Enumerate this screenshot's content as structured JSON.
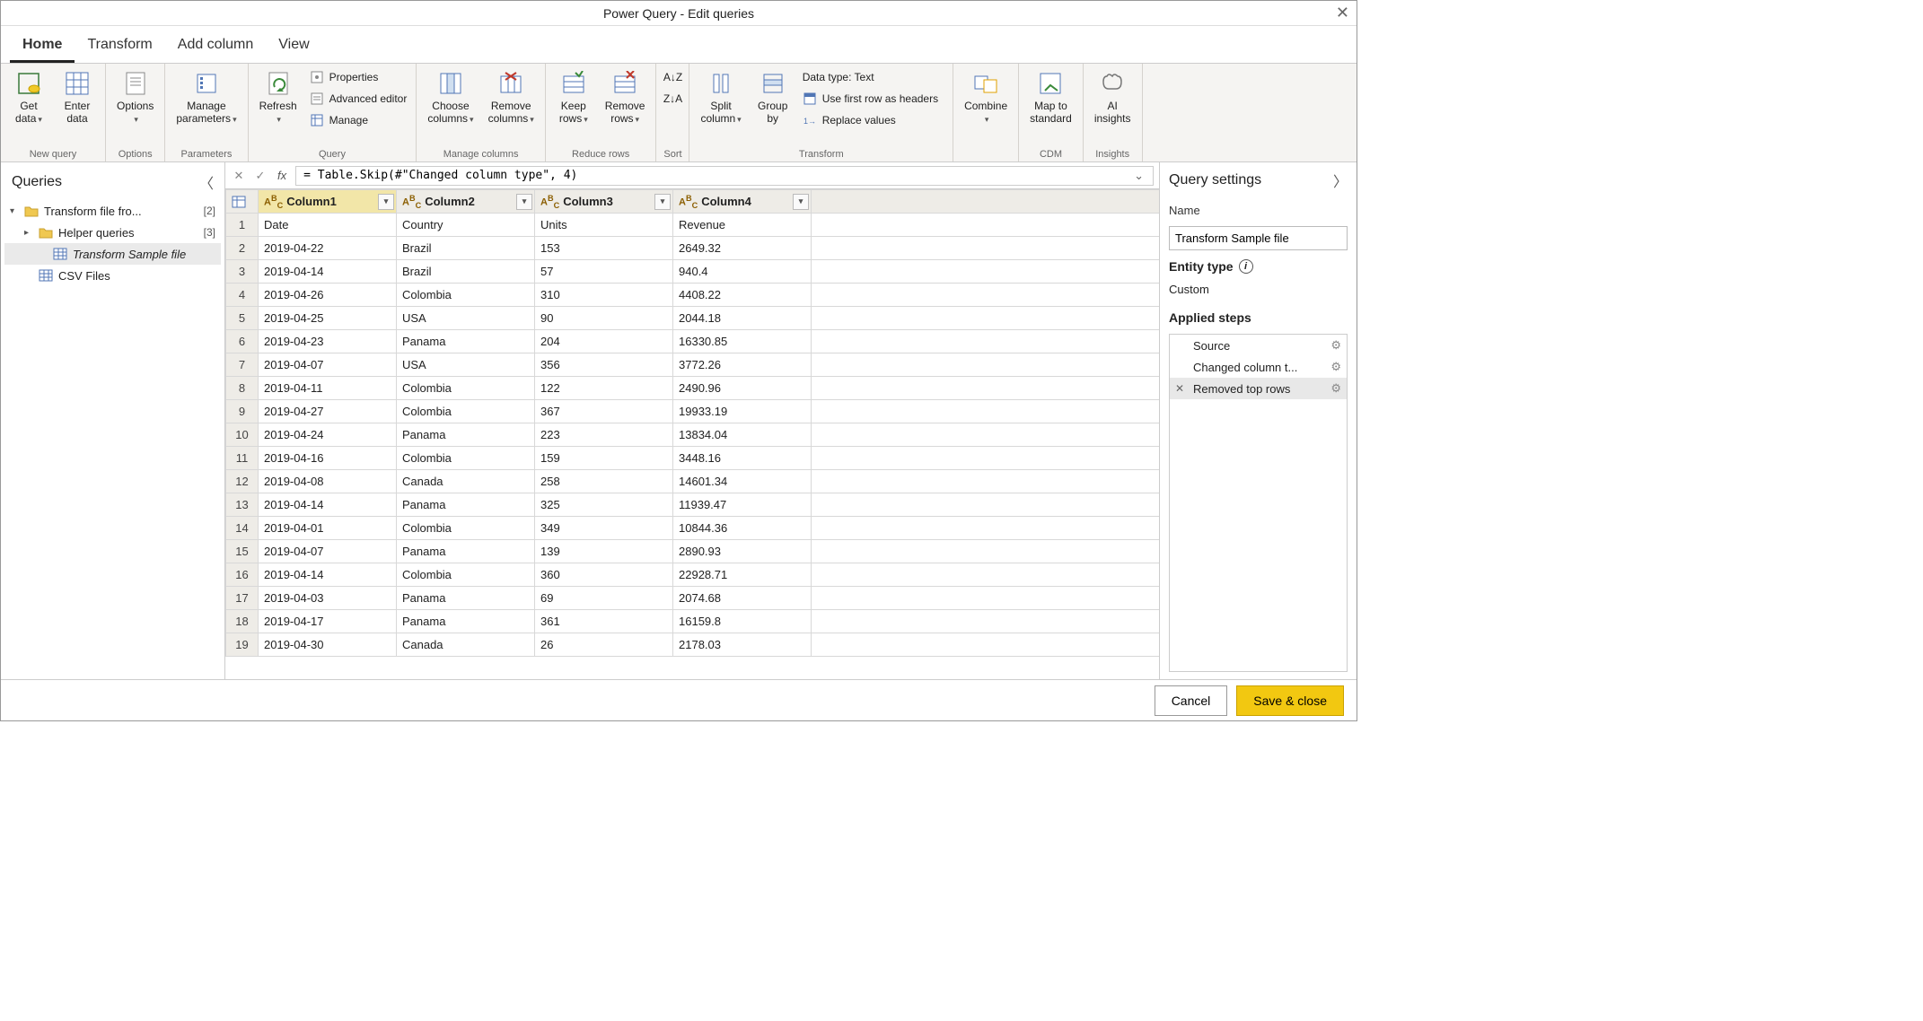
{
  "window": {
    "title": "Power Query - Edit queries"
  },
  "tabs": [
    {
      "label": "Home",
      "active": true
    },
    {
      "label": "Transform",
      "active": false
    },
    {
      "label": "Add column",
      "active": false
    },
    {
      "label": "View",
      "active": false
    }
  ],
  "ribbon": {
    "groups": {
      "new_query": {
        "label": "New query",
        "get_data": "Get\ndata",
        "enter_data": "Enter\ndata"
      },
      "options": {
        "label": "Options",
        "options_btn": "Options"
      },
      "parameters": {
        "label": "Parameters",
        "manage_parameters": "Manage\nparameters"
      },
      "query": {
        "label": "Query",
        "refresh": "Refresh",
        "properties": "Properties",
        "advanced": "Advanced editor",
        "manage": "Manage"
      },
      "manage_columns": {
        "label": "Manage columns",
        "choose": "Choose\ncolumns",
        "remove": "Remove\ncolumns"
      },
      "reduce_rows": {
        "label": "Reduce rows",
        "keep": "Keep\nrows",
        "remove": "Remove\nrows"
      },
      "sort": {
        "label": "Sort"
      },
      "transform": {
        "label": "Transform",
        "split": "Split\ncolumn",
        "groupby": "Group\nby",
        "datatype": "Data type: Text",
        "firstrow": "Use first row as headers",
        "replace": "Replace values"
      },
      "combine": {
        "label": "",
        "combine_btn": "Combine"
      },
      "cdm": {
        "label": "CDM",
        "map": "Map to\nstandard"
      },
      "insights": {
        "label": "Insights",
        "ai": "AI\ninsights"
      }
    }
  },
  "queries": {
    "title": "Queries",
    "items": [
      {
        "label": "Transform file fro...",
        "count": "[2]",
        "type": "folder",
        "expanded": true,
        "indent": 0
      },
      {
        "label": "Helper queries",
        "count": "[3]",
        "type": "folder",
        "expanded": false,
        "indent": 1
      },
      {
        "label": "Transform Sample file",
        "type": "table",
        "indent": 2,
        "selected": true
      },
      {
        "label": "CSV Files",
        "type": "table",
        "indent": 1
      }
    ]
  },
  "formula": {
    "text": "= Table.Skip(#\"Changed column type\", 4)"
  },
  "table": {
    "columns": [
      {
        "name": "Column1",
        "type": "ABC",
        "selected": true
      },
      {
        "name": "Column2",
        "type": "ABC"
      },
      {
        "name": "Column3",
        "type": "ABC"
      },
      {
        "name": "Column4",
        "type": "ABC"
      }
    ],
    "rows": [
      [
        "Date",
        "Country",
        "Units",
        "Revenue"
      ],
      [
        "2019-04-22",
        "Brazil",
        "153",
        "2649.32"
      ],
      [
        "2019-04-14",
        "Brazil",
        "57",
        "940.4"
      ],
      [
        "2019-04-26",
        "Colombia",
        "310",
        "4408.22"
      ],
      [
        "2019-04-25",
        "USA",
        "90",
        "2044.18"
      ],
      [
        "2019-04-23",
        "Panama",
        "204",
        "16330.85"
      ],
      [
        "2019-04-07",
        "USA",
        "356",
        "3772.26"
      ],
      [
        "2019-04-11",
        "Colombia",
        "122",
        "2490.96"
      ],
      [
        "2019-04-27",
        "Colombia",
        "367",
        "19933.19"
      ],
      [
        "2019-04-24",
        "Panama",
        "223",
        "13834.04"
      ],
      [
        "2019-04-16",
        "Colombia",
        "159",
        "3448.16"
      ],
      [
        "2019-04-08",
        "Canada",
        "258",
        "14601.34"
      ],
      [
        "2019-04-14",
        "Panama",
        "325",
        "11939.47"
      ],
      [
        "2019-04-01",
        "Colombia",
        "349",
        "10844.36"
      ],
      [
        "2019-04-07",
        "Panama",
        "139",
        "2890.93"
      ],
      [
        "2019-04-14",
        "Colombia",
        "360",
        "22928.71"
      ],
      [
        "2019-04-03",
        "Panama",
        "69",
        "2074.68"
      ],
      [
        "2019-04-17",
        "Panama",
        "361",
        "16159.8"
      ],
      [
        "2019-04-30",
        "Canada",
        "26",
        "2178.03"
      ]
    ]
  },
  "settings": {
    "title": "Query settings",
    "name_label": "Name",
    "name_value": "Transform Sample file",
    "entity_label": "Entity type",
    "entity_value": "Custom",
    "steps_label": "Applied steps",
    "steps": [
      {
        "label": "Source",
        "gear": true
      },
      {
        "label": "Changed column t...",
        "gear": true
      },
      {
        "label": "Removed top rows",
        "gear": true,
        "selected": true,
        "deletable": true
      }
    ]
  },
  "footer": {
    "cancel": "Cancel",
    "save": "Save & close"
  }
}
